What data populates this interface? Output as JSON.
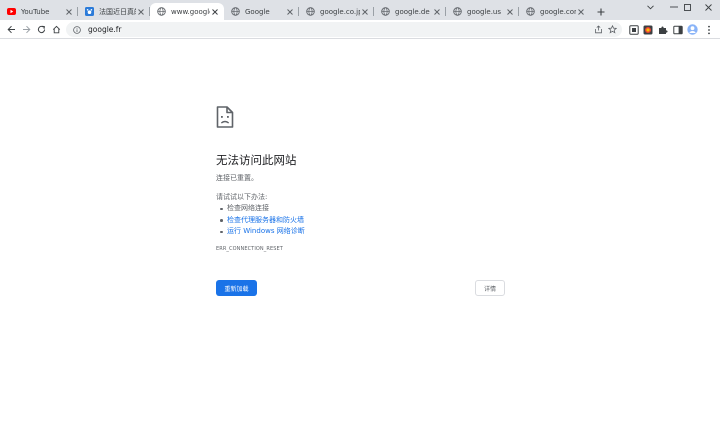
{
  "tabs": [
    {
      "title": "YouTube",
      "favicon": "youtube-icon",
      "active": false
    },
    {
      "title": "法国近日真的要…",
      "favicon": "baidu-icon",
      "active": false
    },
    {
      "title": "www.google.fr",
      "favicon": "globe-icon",
      "active": true
    },
    {
      "title": "Google",
      "favicon": "globe-icon",
      "active": false
    },
    {
      "title": "google.co.jp",
      "favicon": "globe-icon",
      "active": false
    },
    {
      "title": "google.de",
      "favicon": "globe-icon",
      "active": false
    },
    {
      "title": "google.us",
      "favicon": "globe-icon",
      "active": false
    },
    {
      "title": "google.com",
      "favicon": "globe-icon",
      "active": false
    }
  ],
  "omnibox": {
    "url": "google.fr"
  },
  "error": {
    "title": "无法访问此网站",
    "subtitle": "连接已重置。",
    "try_heading": "请试试以下办法:",
    "suggestions": [
      {
        "text": "检查网络连接",
        "link": false
      },
      {
        "text": "检查代理服务器和防火墙",
        "link": true
      },
      {
        "text": "运行 Windows 网络诊断",
        "link": true
      }
    ],
    "code": "ERR_CONNECTION_RESET",
    "reload_label": "重新加载",
    "details_label": "详情"
  },
  "colors": {
    "accent": "#1a73e8",
    "tabstrip": "#dee1e6",
    "omnibox": "#f1f3f4",
    "youtube": "#ff0000",
    "baidu": "#2b7bd9"
  }
}
